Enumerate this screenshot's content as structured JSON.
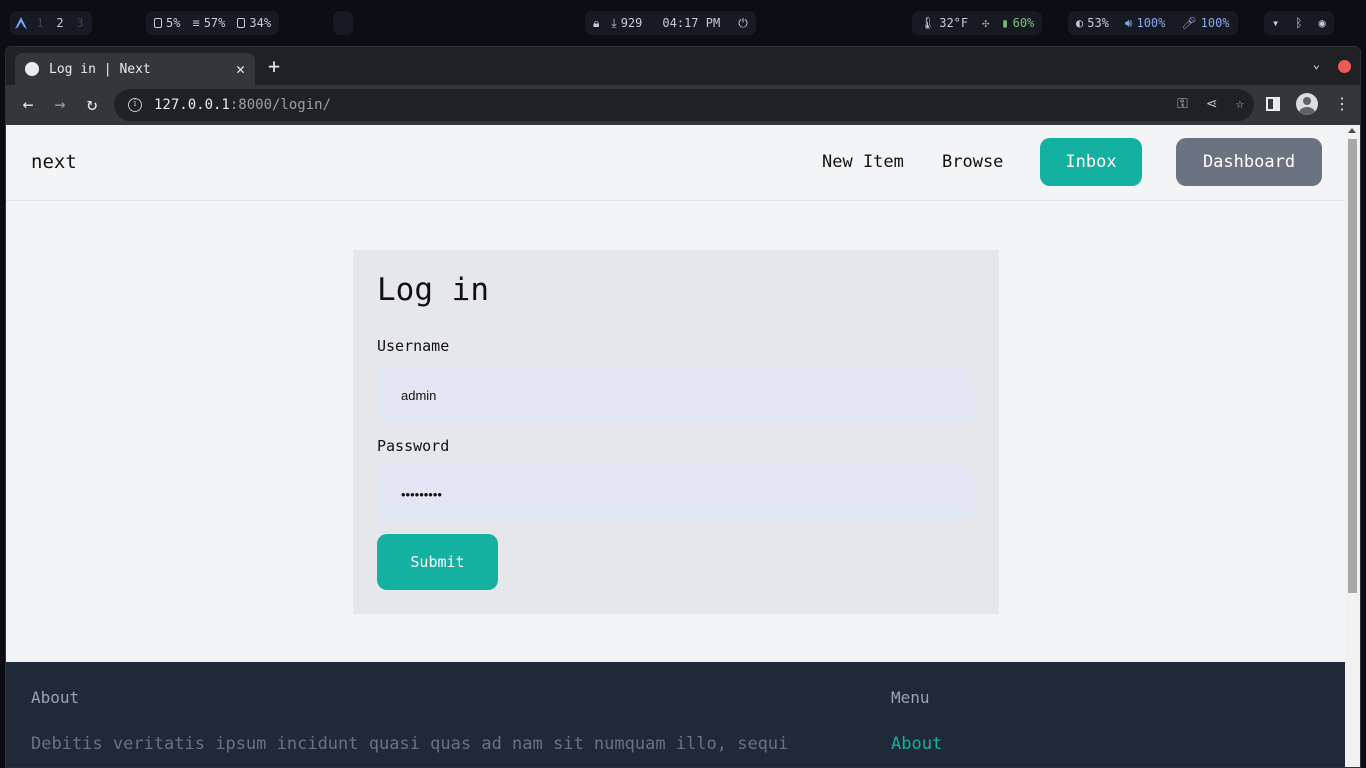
{
  "system_bar": {
    "workspaces": [
      "1",
      "2",
      "3"
    ],
    "active_workspace": "2",
    "cpu": "5%",
    "memory": "57%",
    "disk": "34%",
    "downloads": "929",
    "clock": "04:17 PM",
    "temperature": "32°F",
    "battery": "60%",
    "brightness": "53%",
    "volume": "100%",
    "mic": "100%"
  },
  "browser": {
    "tab_title": "Log in | Next",
    "url_host": "127.0.0.1",
    "url_rest": ":8000/login/"
  },
  "site": {
    "logo": "next",
    "nav": {
      "new_item": "New Item",
      "browse": "Browse",
      "inbox": "Inbox",
      "dashboard": "Dashboard"
    }
  },
  "login_form": {
    "title": "Log in",
    "username_label": "Username",
    "username_value": "admin",
    "password_label": "Password",
    "password_value": "•••••••••",
    "submit_label": "Submit"
  },
  "footer": {
    "about_heading": "About",
    "about_text": "Debitis veritatis ipsum incidunt quasi quas ad nam sit numquam illo, sequi",
    "menu_heading": "Menu",
    "menu_items": [
      "About"
    ]
  },
  "colors": {
    "accent": "#14b0a0",
    "dashboard_button": "#6b7280",
    "footer_bg": "#1f2937",
    "card_bg": "#e5e7eb",
    "input_bg": "#e1e6f3"
  },
  "icons": {
    "system_bar": [
      "arch-logo-icon",
      "cpu-icon",
      "memory-icon",
      "disk-icon",
      "lock-icon",
      "download-icon",
      "power-icon",
      "thermometer-icon",
      "fan-icon",
      "battery-icon",
      "brightness-icon",
      "volume-icon",
      "mic-icon",
      "wifi-icon",
      "bluetooth-icon",
      "settings-icon"
    ],
    "browser": [
      "globe-icon",
      "close-icon",
      "plus-icon",
      "chevron-down-icon",
      "back-icon",
      "forward-icon",
      "reload-icon",
      "info-icon",
      "key-icon",
      "share-icon",
      "star-icon",
      "side-panel-icon",
      "profile-icon",
      "kebab-menu-icon"
    ]
  }
}
